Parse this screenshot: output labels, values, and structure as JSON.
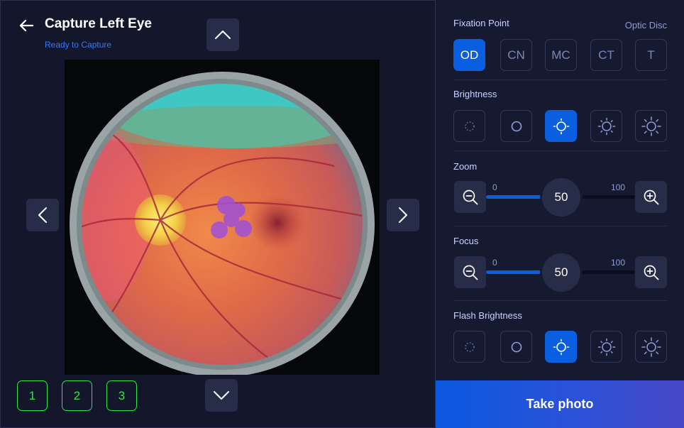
{
  "header": {
    "title": "Capture Left Eye",
    "status": "Ready to Capture"
  },
  "presets": [
    "1",
    "2",
    "3"
  ],
  "fixation": {
    "label": "Fixation Point",
    "selected_name": "Optic Disc",
    "options": [
      "OD",
      "CN",
      "MC",
      "CT",
      "T"
    ],
    "active_index": 0
  },
  "brightness": {
    "label": "Brightness",
    "levels": 5,
    "active_index": 2
  },
  "zoom": {
    "label": "Zoom",
    "min": "0",
    "max": "100",
    "value": "50"
  },
  "focus": {
    "label": "Focus",
    "min": "0",
    "max": "100",
    "value": "50"
  },
  "flash": {
    "label": "Flash Brightness",
    "levels": 5,
    "active_index": 2
  },
  "actions": {
    "take_photo": "Take photo"
  },
  "colors": {
    "accent": "#0a5ee0",
    "status_blue": "#2f7bff",
    "preset_green": "#2fe64a"
  }
}
